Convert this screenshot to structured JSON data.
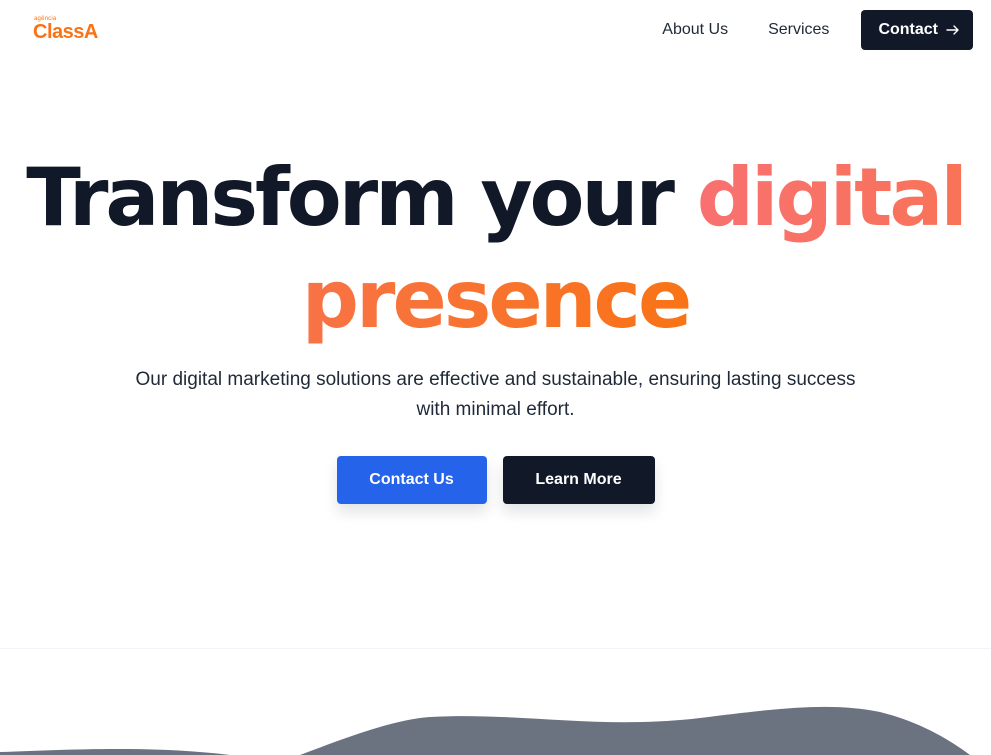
{
  "brand": {
    "logo_small": "agência",
    "logo_main": "ClassA",
    "color": "#f97316"
  },
  "nav": {
    "items": [
      {
        "label": "About Us"
      },
      {
        "label": "Services"
      }
    ],
    "contact_label": "Contact",
    "contact_icon": "arrow-right-icon"
  },
  "hero": {
    "headline_part1": "Transform your ",
    "headline_part2": "digital",
    "headline_part3": "presence",
    "subtitle": "Our digital marketing solutions are effective and sustainable, ensuring lasting success with minimal effort.",
    "primary_cta": "Contact Us",
    "secondary_cta": "Learn More"
  },
  "colors": {
    "primary_button": "#2563eb",
    "dark": "#111827",
    "accent_gradient_start": "#f87171",
    "accent_gradient_end": "#f97316",
    "wave": "#6b7280"
  }
}
